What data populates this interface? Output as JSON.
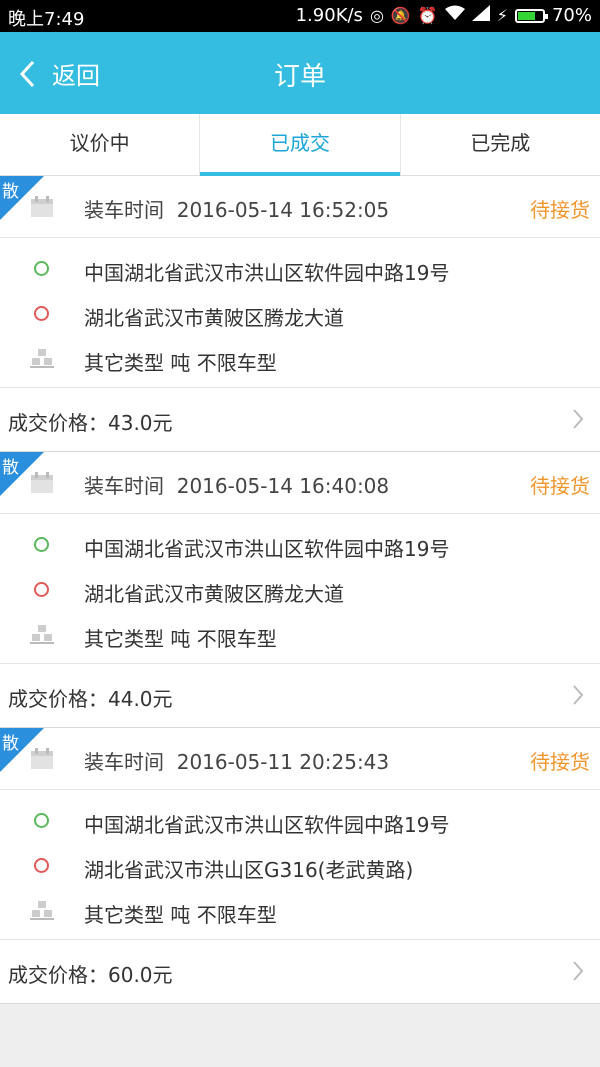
{
  "statusbar": {
    "time": "晚上7:49",
    "speed": "1.90K/s",
    "battery": "70%",
    "battery_level": 0.7
  },
  "nav": {
    "back_label": "返回",
    "title": "订单"
  },
  "tabs": [
    {
      "label": "议价中",
      "active": false
    },
    {
      "label": "已成交",
      "active": true
    },
    {
      "label": "已完成",
      "active": false
    }
  ],
  "orders": [
    {
      "badge": "散",
      "load_time_label": "装车时间",
      "load_time": "2016-05-14 16:52:05",
      "status": "待接货",
      "from": "中国湖北省武汉市洪山区软件园中路19号",
      "to": "湖北省武汉市黄陂区腾龙大道",
      "cargo": "其它类型 吨 不限车型",
      "price": "成交价格：43.0元"
    },
    {
      "badge": "散",
      "load_time_label": "装车时间",
      "load_time": "2016-05-14 16:40:08",
      "status": "待接货",
      "from": "中国湖北省武汉市洪山区软件园中路19号",
      "to": "湖北省武汉市黄陂区腾龙大道",
      "cargo": "其它类型 吨 不限车型",
      "price": "成交价格：44.0元"
    },
    {
      "badge": "散",
      "load_time_label": "装车时间",
      "load_time": "2016-05-11 20:25:43",
      "status": "待接货",
      "from": "中国湖北省武汉市洪山区软件园中路19号",
      "to": "湖北省武汉市洪山区G316(老武黄路)",
      "cargo": "其它类型 吨 不限车型",
      "price": "成交价格：60.0元"
    }
  ],
  "colors": {
    "accent": "#34bde0",
    "status": "#f0962c",
    "ribbon": "#2a8fdc"
  }
}
